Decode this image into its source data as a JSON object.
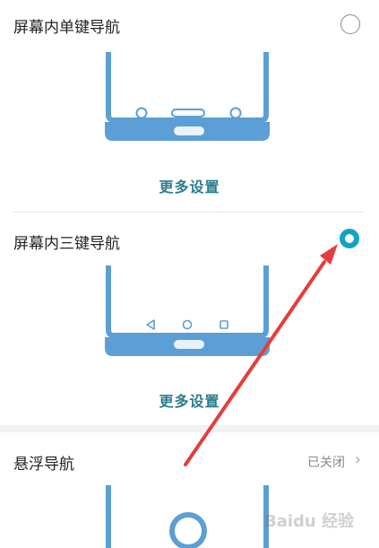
{
  "options": [
    {
      "title": "屏幕内单键导航",
      "selected": false,
      "more_label": "更多设置"
    },
    {
      "title": "屏幕内三键导航",
      "selected": true,
      "more_label": "更多设置"
    }
  ],
  "float_nav": {
    "title": "悬浮导航",
    "status": "已关闭"
  },
  "watermark": "Baidu 经验",
  "colors": {
    "phone_blue": "#5b9fd6",
    "accent": "#12a3c4",
    "annotation_arrow": "#e63c3c"
  }
}
